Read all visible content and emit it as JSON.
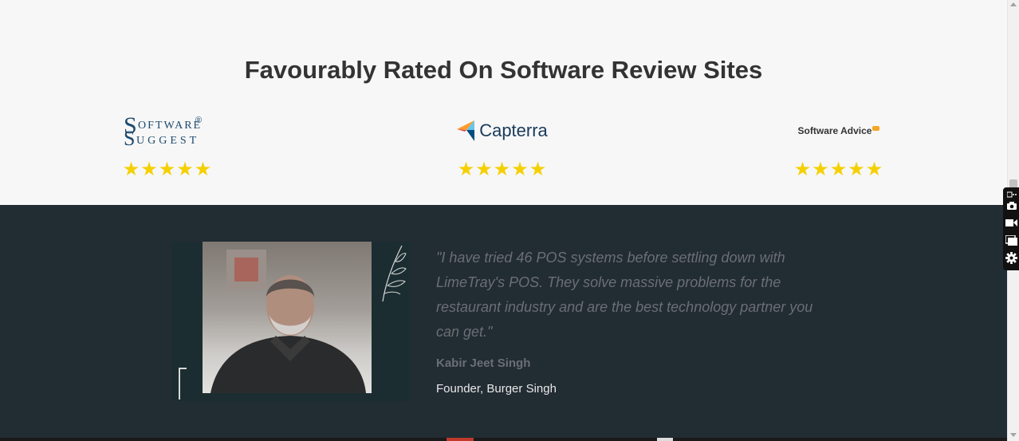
{
  "rated": {
    "title": "Favourably Rated On Software Review Sites",
    "sites": [
      {
        "name": "SoftwareSuggest",
        "stars": "★★★★★",
        "rating": 5
      },
      {
        "name": "Capterra",
        "logo_text": "Capterra",
        "stars": "★★★★★",
        "rating": 5
      },
      {
        "name": "Software Advice",
        "logo_text": "Software Advice",
        "stars": "★★★★★",
        "rating": 5
      }
    ],
    "star_color": "#f5d000",
    "ss_logo": {
      "s1": "S",
      "w1": "OFTWARE",
      "s2": "S",
      "w2": "UGGEST",
      "reg": "®"
    }
  },
  "testimonial": {
    "quote": "\"I have tried 46 POS systems before settling down with LimeTray's POS. They solve massive problems for the restaurant industry and are the best technology partner you can get.\"",
    "author": "Kabir Jeet Singh",
    "role": "Founder, Burger Singh",
    "background_color": "#222c33"
  },
  "tool_icons": [
    "screenshot-icon",
    "camera-icon",
    "video-icon",
    "window-icon",
    "gear-icon"
  ]
}
